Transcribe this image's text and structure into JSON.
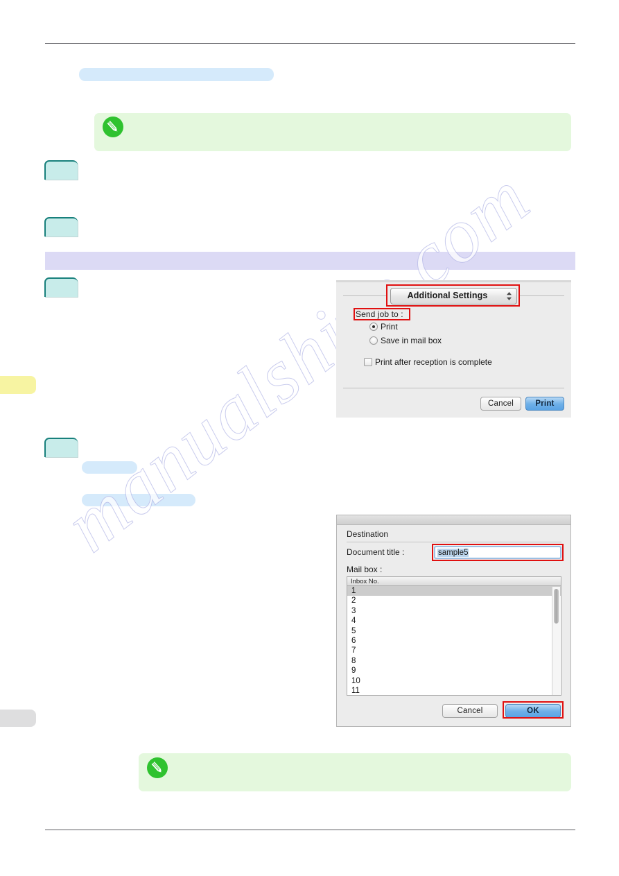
{
  "page": {
    "watermark": "manualshive.com",
    "rules": {
      "top": "",
      "bottom": ""
    }
  },
  "dialog_print": {
    "popup_menu": {
      "selected": "Additional Settings",
      "icon": "chevron-updown-icon"
    },
    "send_job_label": "Send job to :",
    "radio_options": [
      {
        "label": "Print",
        "selected": true
      },
      {
        "label": "Save in mail box",
        "selected": false
      }
    ],
    "checkbox": {
      "label": "Print after reception is complete",
      "checked": false
    },
    "buttons": {
      "cancel": "Cancel",
      "print": "Print"
    },
    "highlight_color": "#e01010"
  },
  "dialog_destination": {
    "group_label": "Destination",
    "document_title": {
      "label": "Document title :",
      "value": "sample5"
    },
    "mail_box": {
      "label": "Mail box :",
      "column_header": "Inbox No.",
      "selected_index": 0,
      "rows": [
        "1",
        "2",
        "3",
        "4",
        "5",
        "6",
        "7",
        "8",
        "9",
        "10",
        "11"
      ]
    },
    "buttons": {
      "cancel": "Cancel",
      "ok": "OK"
    },
    "highlight_color": "#e01010"
  },
  "margin_tabs": {
    "yellow": "",
    "gray": ""
  },
  "steps": {
    "step_1": "",
    "step_2": "",
    "step_3": "",
    "step_4": ""
  },
  "redacted": {
    "heading_pill": "",
    "small_pill": "",
    "medium_pill": "",
    "section_banner": ""
  },
  "notes": {
    "top": "",
    "bottom": "",
    "icon": "pencil-note-icon"
  }
}
